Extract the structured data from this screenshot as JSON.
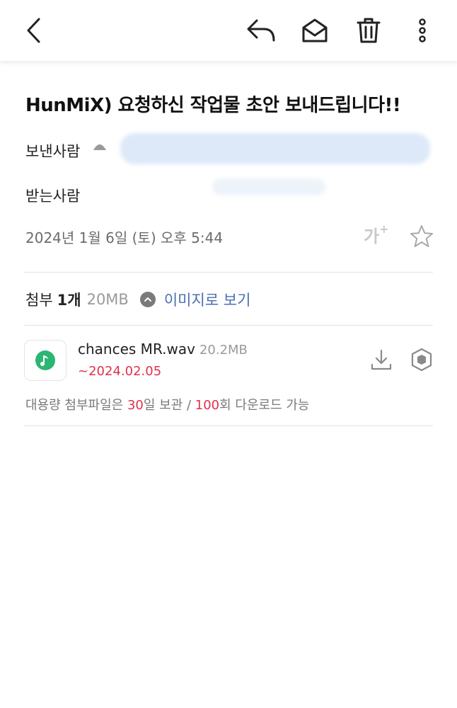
{
  "toolbar": {
    "back": "back-arrow-icon",
    "reply": "reply-icon",
    "mark_unread": "envelope-icon",
    "delete": "trash-icon",
    "more": "more-vertical-icon"
  },
  "mail": {
    "subject": "HunMiX) 요청하신 작업물 초안 보내드립니다!!",
    "sender_label": "보낸사람",
    "recipient_label": "받는사람",
    "date": "2024년 1월 6일 (토) 오후 5:44",
    "font_size_label": "가",
    "font_size_plus": "+"
  },
  "attachments": {
    "label": "첨부",
    "count": "1개",
    "total_size": "20MB",
    "view_images_label": "이미지로 보기",
    "files": [
      {
        "name": "chances MR.wav",
        "size": "20.2MB",
        "expires": "~2024.02.05"
      }
    ],
    "notice_prefix": "대용량 첨부파일은 ",
    "notice_days": "30",
    "notice_mid": "일 보관 / ",
    "notice_downloads": "100",
    "notice_suffix": "회 다운로드 가능"
  },
  "colors": {
    "accent_blue": "#4a6fb0",
    "expire_red": "#e0314b",
    "audio_green": "#2bb673"
  }
}
